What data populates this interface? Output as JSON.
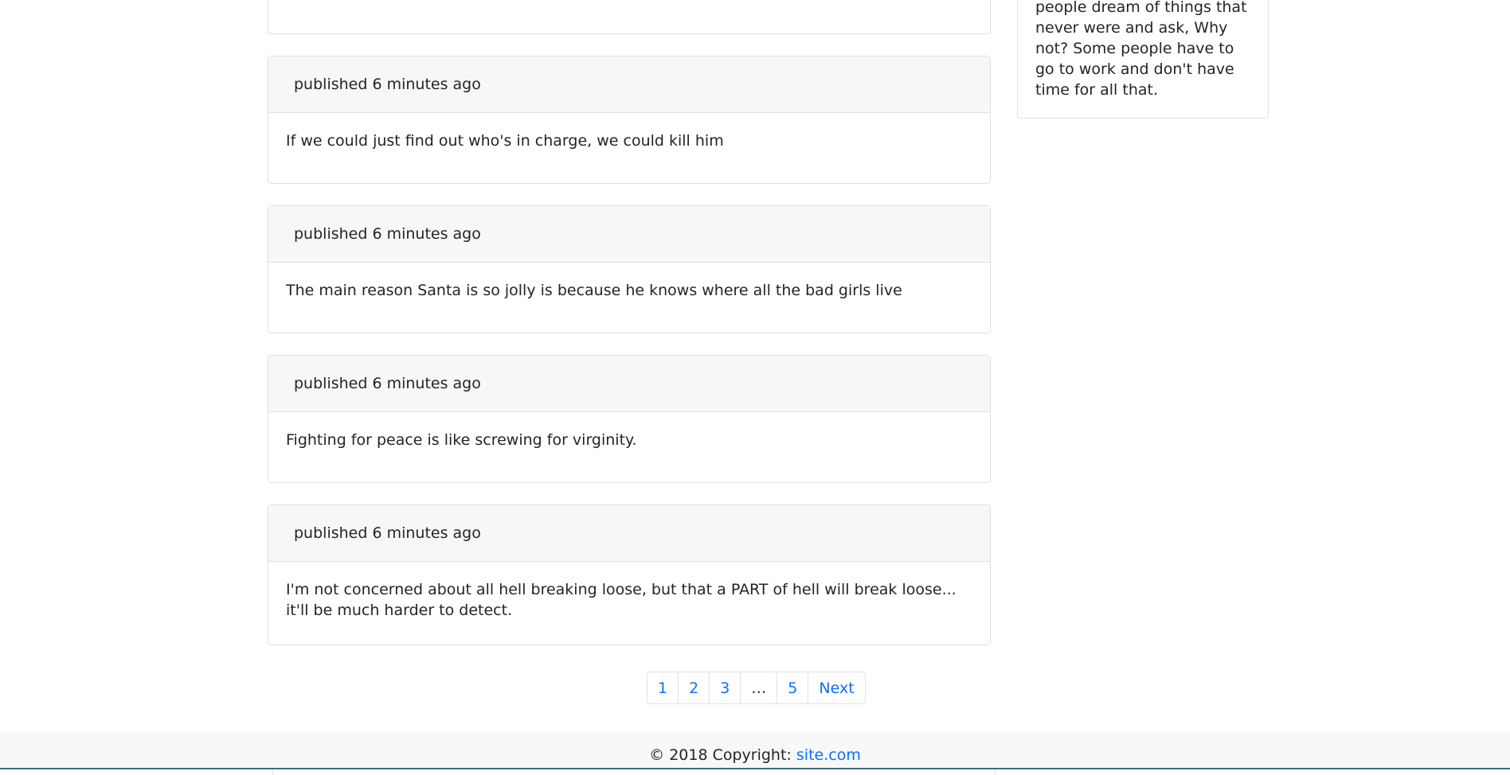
{
  "sidebar": {
    "text": "people dream of things that never were and ask, Why not? Some people have to go to work and don't have time for all that."
  },
  "posts": [
    {
      "meta": "published 6 minutes ago",
      "text": "If we could just find out who's in charge, we could kill him"
    },
    {
      "meta": "published 6 minutes ago",
      "text": "The main reason Santa is so jolly is because he knows where all the bad girls live"
    },
    {
      "meta": "published 6 minutes ago",
      "text": "Fighting for peace is like screwing for virginity."
    },
    {
      "meta": "published 6 minutes ago",
      "text": "I'm not concerned about all hell breaking loose, but that a PART of hell will break loose... it'll be much harder to detect."
    }
  ],
  "pagination": {
    "pages": [
      "1",
      "2",
      "3",
      "…",
      "5"
    ],
    "next": "Next"
  },
  "footer": {
    "copyright": "© 2018 Copyright:",
    "link": "site.com"
  },
  "colors": {
    "link": "#0d6efd",
    "card_header_bg": "#f7f7f7",
    "footer_bg": "#f7f8f9"
  }
}
